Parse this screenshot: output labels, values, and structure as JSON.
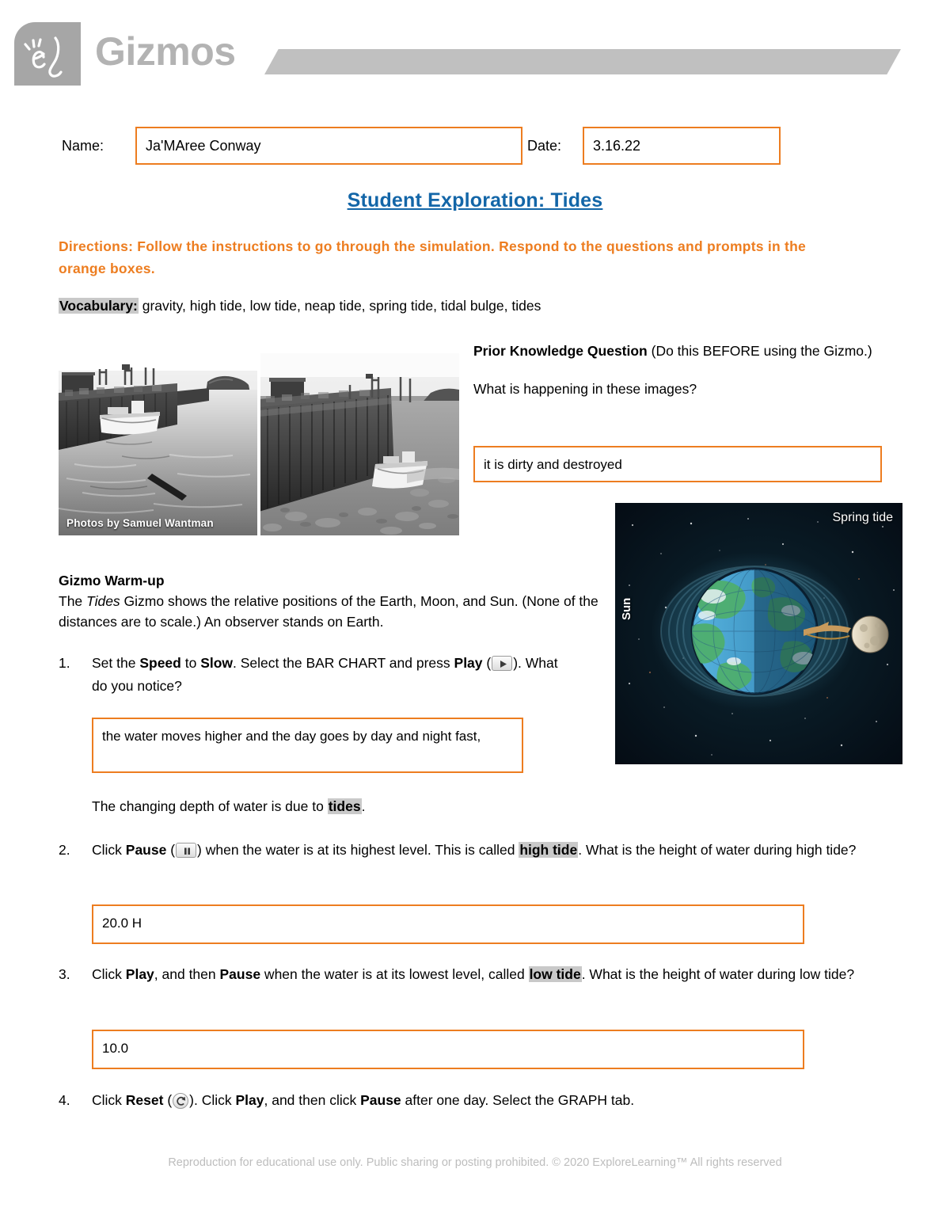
{
  "brand": {
    "name": "Gizmos",
    "logo_glyph": "el",
    "logo_color": "#a6a6a6",
    "bar_color": "#c0c0c0"
  },
  "form": {
    "name_label": "Name:",
    "name_value": "Ja'MAree Conway",
    "name_placeholder": "",
    "date_label": "Date:",
    "date_value": "3.16.22",
    "date_placeholder": ""
  },
  "title": "Student Exploration: Tides",
  "title_color": "#1366a8",
  "directions": "Directions: Follow the instructions to go through the simulation. Respond to the questions and prompts in the orange boxes.",
  "directions_color": "#ed7d20",
  "vocabulary": {
    "label": "Vocabulary:",
    "terms": "gravity, high tide, low tide, neap tide, spring tide, tidal bulge, tides"
  },
  "photos": {
    "credit": "Photos by Samuel Wantman"
  },
  "prior_knowledge": {
    "heading_bold": "Prior Knowledge Question",
    "heading_rest": " (Do this BEFORE using the Gizmo.)",
    "question": "What is happening in these images?",
    "answer": "it is dirty and destroyed"
  },
  "simulation": {
    "label_spring_tide": "Spring tide",
    "label_sun": "Sun"
  },
  "warmup": {
    "title": "Gizmo Warm-up",
    "line1_pre": "The ",
    "line1_italic": "Tides",
    "line1_post": " Gizmo shows the relative positions of the Earth, Moon, and Sun. (None of the distances are to scale.) An observer stands on Earth."
  },
  "questions": [
    {
      "number": "1.",
      "text_parts": {
        "a": "Set the ",
        "b_bold": "Speed",
        "c": " to ",
        "d_bold": "Slow",
        "e": ". Select the BAR CHART and press ",
        "f_bold": "Play",
        "g": " (",
        "icon": "play-icon",
        "h": "). What do you notice?"
      },
      "answer": "the water moves higher and the day goes by day and night fast,"
    },
    {
      "number": "2.",
      "text_parts": {
        "a": "Click ",
        "b_bold": "Pause",
        "c": " (",
        "icon": "pause-icon",
        "d": ") when the water is at its highest level. This is called ",
        "e_hl": "high tide",
        "f": ". What is the height of water during high tide?"
      },
      "answer": "20.0 H"
    },
    {
      "number": "3.",
      "text_parts": {
        "a": "Click ",
        "b_bold": "Play",
        "c": ", and then ",
        "d_bold": "Pause",
        "e": " when the water is at its lowest level, called ",
        "f_hl": "low tide",
        "g": ". What is the height of water during low tide?"
      },
      "answer": "10.0"
    },
    {
      "number": "4.",
      "text_parts": {
        "a": "Click ",
        "b_bold": "Reset",
        "c": " (",
        "icon": "reset-icon",
        "d": "). Click ",
        "e_bold": "Play",
        "f": ", and then click ",
        "g_bold": "Pause",
        "h": " after one day. Select the GRAPH tab."
      },
      "answer": null
    }
  ],
  "tides_sentence": {
    "pre": "The changing depth of water is due to ",
    "highlight": "tides",
    "post": "."
  },
  "footer": "Reproduction for educational use only. Public sharing or posting prohibited. © 2020 ExploreLearning™ All rights reserved"
}
